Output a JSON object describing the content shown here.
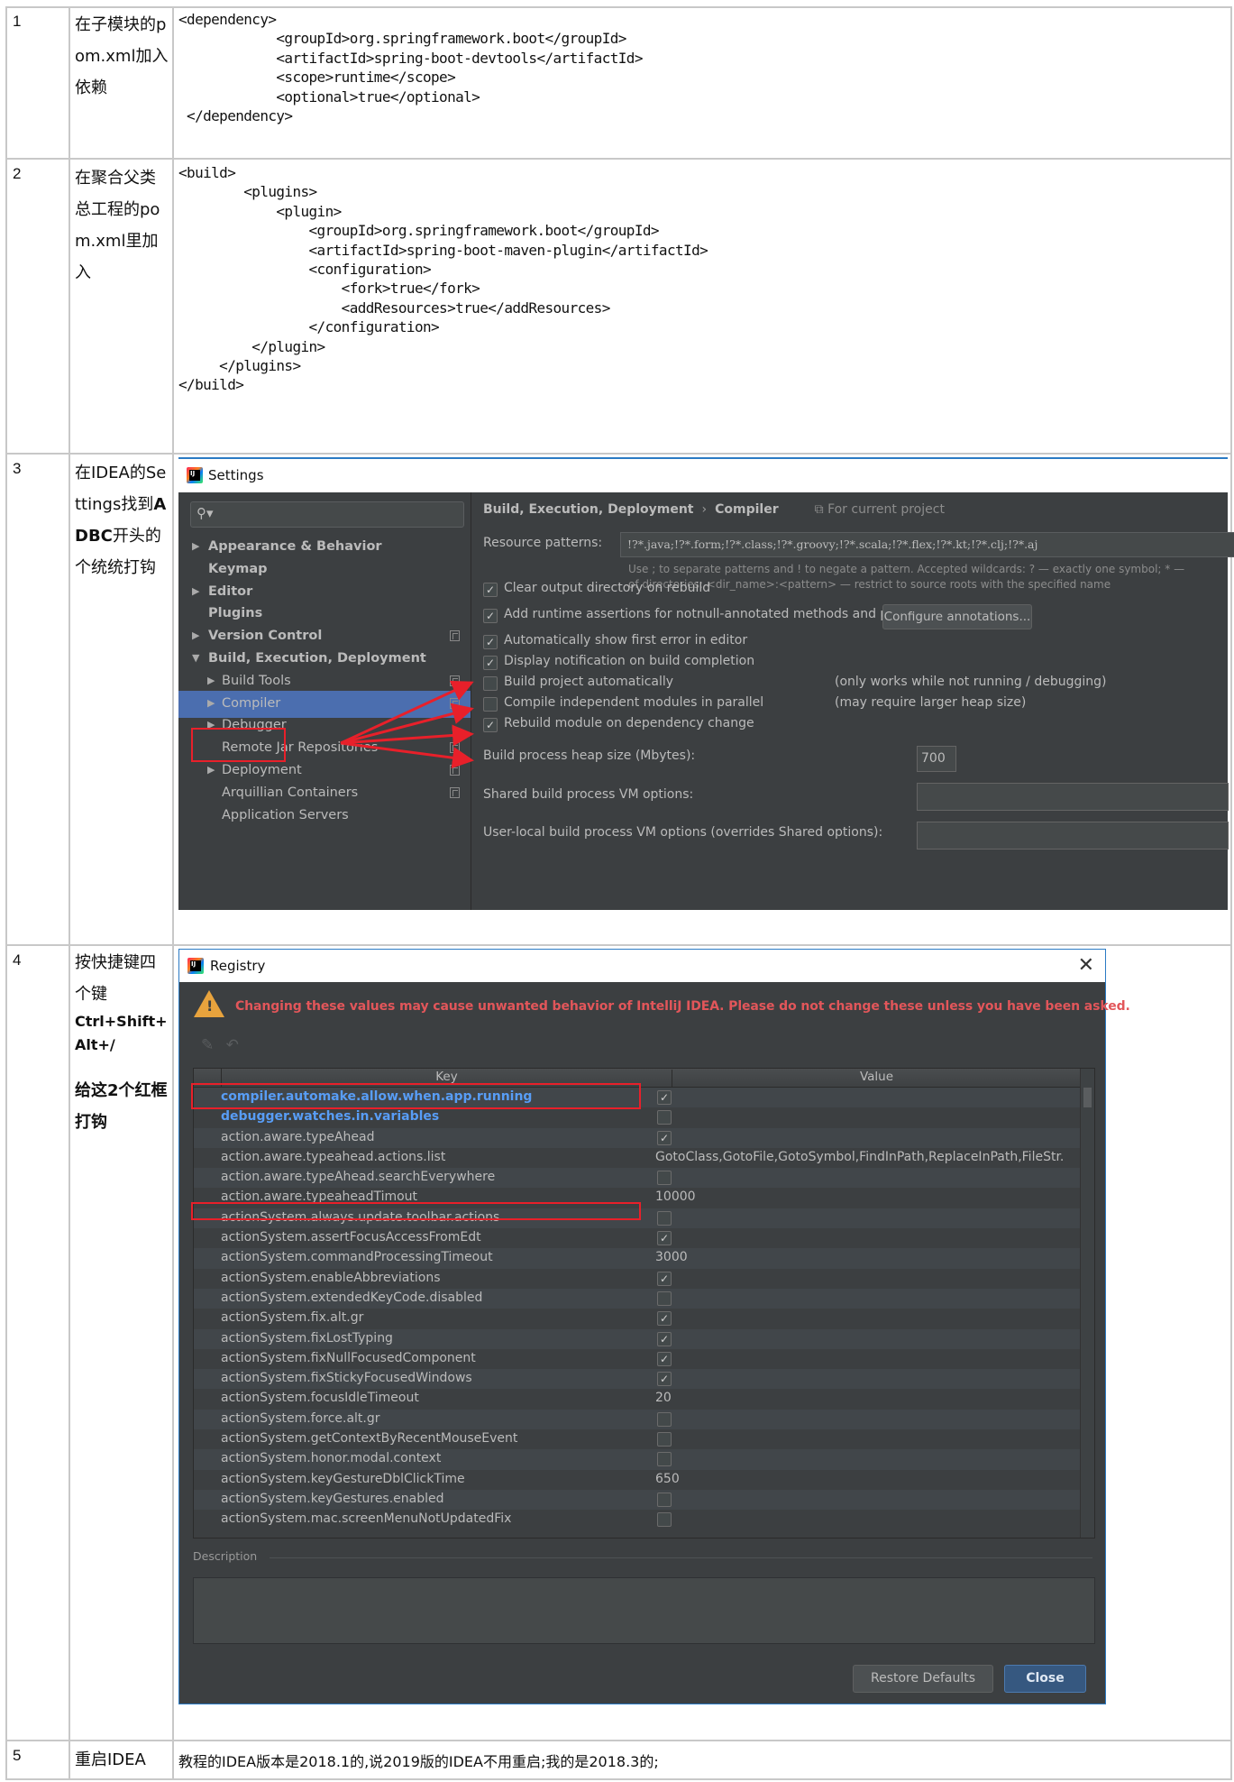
{
  "rows": [
    {
      "num": "1",
      "desc": "在子模块的pom.xml加入依赖",
      "code": "<dependency>\n            <groupId>org.springframework.boot</groupId>\n            <artifactId>spring-boot-devtools</artifactId>\n            <scope>runtime</scope>\n            <optional>true</optional>\n </dependency>"
    },
    {
      "num": "2",
      "desc": "在聚合父类总工程的pom.xml里加入",
      "code": "<build>\n        <plugins>\n            <plugin>\n                <groupId>org.springframework.boot</groupId>\n                <artifactId>spring-boot-maven-plugin</artifactId>\n                <configuration>\n                    <fork>true</fork>\n                    <addResources>true</addResources>\n                </configuration>\n         </plugin>\n     </plugins>\n</build>"
    },
    {
      "num": "3",
      "desc_plain_1": "在IDEA的Settings找到",
      "desc_bold": "ADBC",
      "desc_plain_2": "开头的个统统打钩"
    },
    {
      "num": "4",
      "desc_plain": "按快捷键四个键",
      "desc_bold_1": "Ctrl+Shift+Alt+/",
      "desc_bold_2": "给这2个红框打钩"
    },
    {
      "num": "5",
      "desc": "重启IDEA",
      "note": "教程的IDEA版本是2018.1的,说2019版的IDEA不用重启;我的是2018.3的;"
    }
  ],
  "settings": {
    "title": "Settings",
    "search_placeholder": "",
    "sidebar": [
      {
        "label": "Appearance & Behavior",
        "arrow": "▶",
        "bold": true
      },
      {
        "label": "Keymap",
        "arrow": "",
        "bold": true
      },
      {
        "label": "Editor",
        "arrow": "▶",
        "bold": true
      },
      {
        "label": "Plugins",
        "arrow": "",
        "bold": true
      },
      {
        "label": "Version Control",
        "arrow": "▶",
        "bold": true,
        "project": true
      },
      {
        "label": "Build, Execution, Deployment",
        "arrow": "▼",
        "bold": true
      },
      {
        "label": "Build Tools",
        "arrow": "▶",
        "project": true
      },
      {
        "label": "Compiler",
        "arrow": "▶",
        "project": true,
        "selected": true
      },
      {
        "label": "Debugger",
        "arrow": "▶"
      },
      {
        "label": "Remote Jar Repositories",
        "arrow": "",
        "project": true
      },
      {
        "label": "Deployment",
        "arrow": "▶",
        "project": true
      },
      {
        "label": "Arquillian Containers",
        "arrow": "",
        "project": true
      },
      {
        "label": "Application Servers",
        "arrow": ""
      }
    ],
    "breadcrumb": {
      "parent": "Build, Execution, Deployment",
      "separator": "›",
      "current": "Compiler",
      "scope": "For current project"
    },
    "resource_patterns_label": "Resource patterns:",
    "resource_patterns_value": "!?*.java;!?*.form;!?*.class;!?*.groovy;!?*.scala;!?*.flex;!?*.kt;!?*.clj;!?*.aj",
    "hint_line_1": "Use ; to separate patterns and ! to negate a pattern. Accepted wildcards: ? — exactly one symbol; * —",
    "hint_line_2": "of directories; <dir_name>:<pattern> — restrict to source roots with the specified name",
    "options": [
      {
        "label": "Clear output directory on rebuild",
        "checked": true,
        "note": ""
      },
      {
        "label": "Add runtime assertions for notnull-annotated methods and parameters",
        "checked": true,
        "note": ""
      },
      {
        "label": "Automatically show first error in editor",
        "checked": true,
        "note": ""
      },
      {
        "label": "Display notification on build completion",
        "checked": true,
        "note": ""
      },
      {
        "label": "Build project automatically",
        "checked": false,
        "note": "(only works while not running / debugging)"
      },
      {
        "label": "Compile independent modules in parallel",
        "checked": false,
        "note": "(may require larger heap size)"
      },
      {
        "label": "Rebuild module on dependency change",
        "checked": true,
        "note": ""
      }
    ],
    "configure_annotations_label": "Configure annotations...",
    "heap_label": "Build process heap size (Mbytes):",
    "heap_value": "700",
    "shared_vm_label": "Shared build process VM options:",
    "shared_vm_value": "",
    "user_vm_label": "User-local build process VM options (overrides Shared options):",
    "user_vm_value": ""
  },
  "registry": {
    "title": "Registry",
    "warning": "Changing these values may cause unwanted behavior of IntelliJ IDEA. Please do not change these unless you have been asked.",
    "col_key": "Key",
    "col_value": "Value",
    "entries": [
      {
        "key": "compiler.automake.allow.when.app.running",
        "type": "bool",
        "value": true,
        "highlight": true
      },
      {
        "key": "debugger.watches.in.variables",
        "type": "bool",
        "value": false,
        "highlight": true
      },
      {
        "key": "action.aware.typeAhead",
        "type": "bool",
        "value": true
      },
      {
        "key": "action.aware.typeahead.actions.list",
        "type": "text",
        "value": "GotoClass,GotoFile,GotoSymbol,FindInPath,ReplaceInPath,FileStr."
      },
      {
        "key": "action.aware.typeAhead.searchEverywhere",
        "type": "bool",
        "value": false
      },
      {
        "key": "action.aware.typeaheadTimout",
        "type": "text",
        "value": "10000"
      },
      {
        "key": "actionSystem.always.update.toolbar.actions",
        "type": "bool",
        "value": false
      },
      {
        "key": "actionSystem.assertFocusAccessFromEdt",
        "type": "bool",
        "value": true
      },
      {
        "key": "actionSystem.commandProcessingTimeout",
        "type": "text",
        "value": "3000"
      },
      {
        "key": "actionSystem.enableAbbreviations",
        "type": "bool",
        "value": true
      },
      {
        "key": "actionSystem.extendedKeyCode.disabled",
        "type": "bool",
        "value": false
      },
      {
        "key": "actionSystem.fix.alt.gr",
        "type": "bool",
        "value": true
      },
      {
        "key": "actionSystem.fixLostTyping",
        "type": "bool",
        "value": true
      },
      {
        "key": "actionSystem.fixNullFocusedComponent",
        "type": "bool",
        "value": true
      },
      {
        "key": "actionSystem.fixStickyFocusedWindows",
        "type": "bool",
        "value": true
      },
      {
        "key": "actionSystem.focusIdleTimeout",
        "type": "text",
        "value": "20"
      },
      {
        "key": "actionSystem.force.alt.gr",
        "type": "bool",
        "value": false
      },
      {
        "key": "actionSystem.getContextByRecentMouseEvent",
        "type": "bool",
        "value": false
      },
      {
        "key": "actionSystem.honor.modal.context",
        "type": "bool",
        "value": false
      },
      {
        "key": "actionSystem.keyGestureDblClickTime",
        "type": "text",
        "value": "650"
      },
      {
        "key": "actionSystem.keyGestures.enabled",
        "type": "bool",
        "value": false
      },
      {
        "key": "actionSystem.mac.screenMenuNotUpdatedFix",
        "type": "bool",
        "value": false
      }
    ],
    "description_label": "Description",
    "description_value": "",
    "restore_defaults_label": "Restore Defaults",
    "close_label": "Close"
  },
  "icons": {
    "check": "✓",
    "close": "✕",
    "search": "🔍︎",
    "warning": "!",
    "edit": "✎",
    "undo": "↶",
    "project_scope": "⧉"
  },
  "colors": {
    "ide_background": "#3c3f41",
    "selection": "#4b6eaf",
    "annotation_red": "#e8202a",
    "warning_text": "#e2565a",
    "highlight_key": "#589df6",
    "dialog_border": "#2b7bc4"
  }
}
